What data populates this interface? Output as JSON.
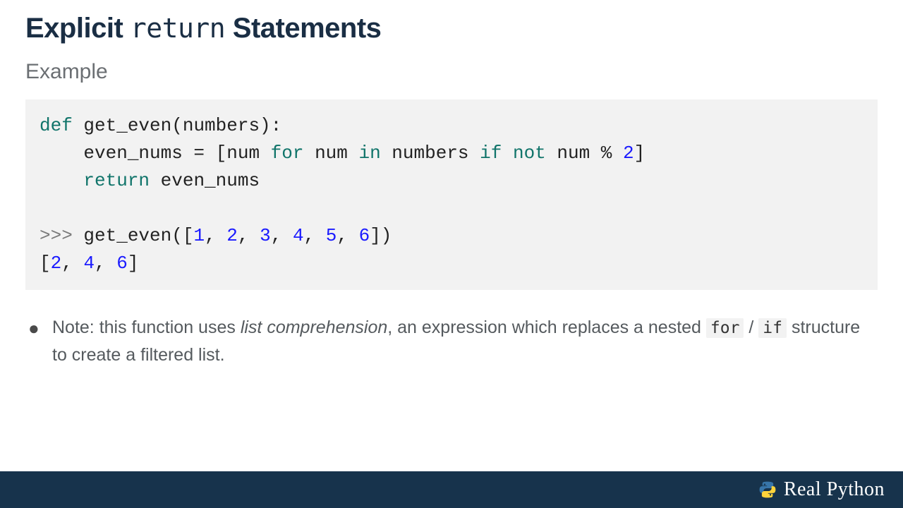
{
  "title": {
    "part1": "Explicit ",
    "keyword": "return",
    "part2": "  Statements"
  },
  "subtitle": "Example",
  "code": {
    "l1": {
      "def": "def",
      "rest": " get_even(numbers):"
    },
    "l2": {
      "indent": "    even_nums = [num ",
      "for": "for",
      "mid1": " num ",
      "in": "in",
      "mid2": " numbers ",
      "if": "if",
      "mid3": " ",
      "not": "not",
      "mid4": " num % ",
      "two": "2",
      "end": "]"
    },
    "l3": {
      "indent": "    ",
      "return": "return",
      "rest": " even_nums"
    },
    "l5": {
      "prompt": ">>>",
      "call_a": " get_even([",
      "n1": "1",
      "c1": ", ",
      "n2": "2",
      "c2": ", ",
      "n3": "3",
      "c3": ", ",
      "n4": "4",
      "c4": ", ",
      "n5": "5",
      "c5": ", ",
      "n6": "6",
      "end": "])"
    },
    "l6": {
      "open": "[",
      "n1": "2",
      "c1": ", ",
      "n2": "4",
      "c2": ", ",
      "n3": "6",
      "close": "]"
    }
  },
  "note": {
    "bullet": "●",
    "a": "Note: this function uses ",
    "em": "list comprehension",
    "b": ", an expression which replaces a nested ",
    "code1": "for",
    "slash": " / ",
    "code2": "if",
    "c": " structure to create a filtered list."
  },
  "brand": "Real Python"
}
